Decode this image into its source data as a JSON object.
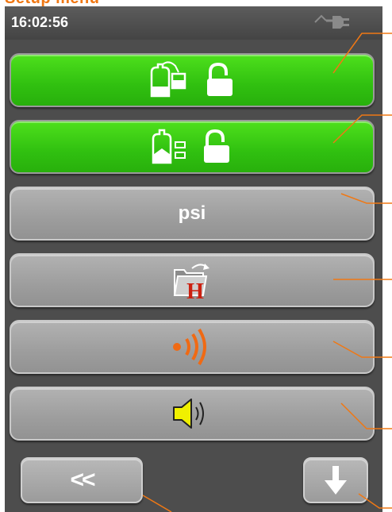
{
  "header": {
    "cut_text": "Setup menu"
  },
  "status_bar": {
    "time": "16:02:56",
    "power_icon": "plug-icon"
  },
  "menu": {
    "buttons": [
      {
        "name": "cylinder-regulator-lock",
        "icon": "cylinder-regulator-icon",
        "state_icon": "unlocked-padlock-icon",
        "color": "#3cd414"
      },
      {
        "name": "cylinder-level-lock",
        "icon": "cylinder-level-icon",
        "state_icon": "unlocked-padlock-icon",
        "color": "#3cd414"
      },
      {
        "name": "pressure-unit",
        "label": "psi",
        "color": "#a6a6a6"
      },
      {
        "name": "folder-history",
        "icon": "folder-h-icon",
        "color": "#a6a6a6"
      },
      {
        "name": "wireless-signal",
        "icon": "wireless-icon",
        "accent": "#f06a14",
        "color": "#a6a6a6"
      },
      {
        "name": "sound-volume",
        "icon": "speaker-icon",
        "accent": "#f0f000",
        "color": "#a6a6a6"
      }
    ]
  },
  "navigation": {
    "back_label": "<<",
    "next_icon": "arrow-down-icon"
  }
}
